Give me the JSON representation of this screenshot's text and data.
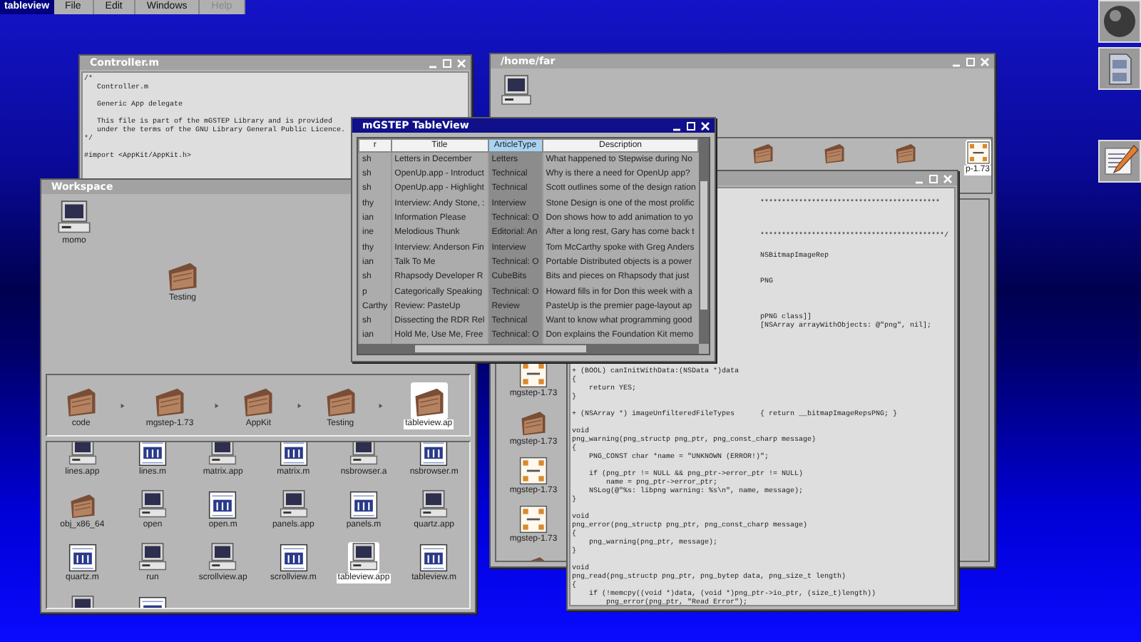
{
  "menu_bar": {
    "app_name": "tableview",
    "items": [
      {
        "label": "File",
        "disabled": false
      },
      {
        "label": "Edit",
        "disabled": false
      },
      {
        "label": "Windows",
        "disabled": false
      },
      {
        "label": "Help",
        "disabled": true
      }
    ]
  },
  "windows": [
    {
      "kind": "editor",
      "title": "Controller.m",
      "active": false,
      "blocks": [
        [
          "/*",
          "   Controller.m"
        ],
        [
          "   Generic App delegate"
        ],
        [
          "   This file is part of the mGSTEP Library and is provided",
          "   under the terms of the GNU Library General Public Licence.",
          "*/"
        ],
        [
          "#import <AppKit/AppKit.h>"
        ]
      ]
    },
    {
      "kind": "file-viewer",
      "title": "/home/far",
      "active": false,
      "shelf": [
        {
          "kind": "monitor"
        }
      ],
      "path": [
        {
          "kind": "folder",
          "selected": false
        },
        {
          "kind": "folder",
          "selected": false
        },
        {
          "kind": "folder",
          "selected": false
        },
        {
          "kind": "archive",
          "label": "p-1.73",
          "selected": true
        }
      ],
      "column": [
        {
          "kind": "archive",
          "label": "mgstep-1.73"
        },
        {
          "kind": "folder",
          "label": "mgstep-1.73"
        },
        {
          "kind": "archive",
          "label": "mgstep-1.73"
        },
        {
          "kind": "archive",
          "label": "mgstep-1.73"
        },
        {
          "kind": "folder"
        }
      ]
    },
    {
      "kind": "editor",
      "active": false,
      "fragments": [
        "******************************************",
        "*******************************************/",
        "NSBitmapImageRep",
        "PNG",
        "pPNG class]]",
        "[NSArray arrayWithObjects: @\"png\", nil];"
      ],
      "blocks": [
        [
          "+ (BOOL) canInitWithData:(NSData *)data",
          "{",
          "    return YES;",
          "}"
        ],
        [
          "+ (NSArray *) imageUnfilteredFileTypes      { return __bitmapImageRepsPNG; }"
        ],
        [
          "void",
          "png_warning(png_structp png_ptr, png_const_charp message)",
          "{",
          "    PNG_CONST char *name = \"UNKNOWN (ERROR!)\";"
        ],
        [
          "    if (png_ptr != NULL && png_ptr->error_ptr != NULL)",
          "        name = png_ptr->error_ptr;",
          "    NSLog(@\"%s: libpng warning: %s\\n\", name, message);",
          "}"
        ],
        [
          "void",
          "png_error(png_structp png_ptr, png_const_charp message)",
          "{",
          "    png_warning(png_ptr, message);",
          "}"
        ],
        [
          "void",
          "png_read(png_structp png_ptr, png_bytep data, png_size_t length)",
          "{",
          "    if (!memcpy((void *)data, (void *)png_ptr->io_ptr, (size_t)length))",
          "        png_error(png_ptr, \"Read Error\");"
        ]
      ]
    },
    {
      "kind": "workspace",
      "title": "Workspace",
      "active": false,
      "shelf": [
        {
          "kind": "monitor",
          "label": "momo"
        },
        {
          "kind": "folder",
          "label": "Testing"
        }
      ],
      "path": [
        {
          "kind": "folder",
          "label": "code",
          "selected": false
        },
        {
          "kind": "folder",
          "label": "mgstep-1.73",
          "selected": false
        },
        {
          "kind": "folder",
          "label": "AppKit",
          "selected": false
        },
        {
          "kind": "folder",
          "label": "Testing",
          "selected": false
        },
        {
          "kind": "folder",
          "label": "tableview.ap",
          "selected": true
        }
      ],
      "grid": [
        {
          "kind": "monitor",
          "label": "lines.app",
          "selected": false
        },
        {
          "kind": "document",
          "label": "lines.m",
          "selected": false
        },
        {
          "kind": "monitor",
          "label": "matrix.app",
          "selected": false
        },
        {
          "kind": "document",
          "label": "matrix.m",
          "selected": false
        },
        {
          "kind": "monitor",
          "label": "nsbrowser.a",
          "selected": false
        },
        {
          "kind": "document",
          "label": "nsbrowser.m",
          "selected": false
        },
        {
          "kind": "folder",
          "label": "obj_x86_64",
          "selected": false
        },
        {
          "kind": "monitor",
          "label": "open",
          "selected": false
        },
        {
          "kind": "document",
          "label": "open.m",
          "selected": false
        },
        {
          "kind": "monitor",
          "label": "panels.app",
          "selected": false
        },
        {
          "kind": "document",
          "label": "panels.m",
          "selected": false
        },
        {
          "kind": "monitor",
          "label": "quartz.app",
          "selected": false
        },
        {
          "kind": "document",
          "label": "quartz.m",
          "selected": false
        },
        {
          "kind": "monitor",
          "label": "run",
          "selected": false
        },
        {
          "kind": "monitor",
          "label": "scrollview.ap",
          "selected": false
        },
        {
          "kind": "document",
          "label": "scrollview.m",
          "selected": false
        },
        {
          "kind": "monitor",
          "label": "tableview.app",
          "selected": true
        },
        {
          "kind": "document",
          "label": "tableview.m",
          "selected": false
        },
        {
          "kind": "monitor",
          "selected": false
        },
        {
          "kind": "document",
          "selected": false
        }
      ]
    },
    {
      "kind": "table",
      "title": "mGSTEP TableView",
      "active": true,
      "columns": [
        {
          "label": "r",
          "selected": false
        },
        {
          "label": "Title",
          "selected": false
        },
        {
          "label": "ArticleType",
          "selected": true
        },
        {
          "label": "Description",
          "selected": false
        }
      ],
      "rows": [
        [
          "sh",
          "Letters in December",
          "Letters",
          "What happened to Stepwise during No"
        ],
        [
          "sh",
          "OpenUp.app - Introduct",
          "Technical",
          "Why is there a need for OpenUp app?"
        ],
        [
          "sh",
          "OpenUp.app - Highlight",
          "Technical",
          "Scott outlines some of the design ration"
        ],
        [
          "thy",
          "Interview: Andy Stone, :",
          "Interview",
          "Stone Design is one of the most prolific"
        ],
        [
          "ian",
          "Information Please",
          "Technical: O",
          "Don shows how to add animation to yo"
        ],
        [
          "ine",
          "Melodious Thunk",
          "Editorial: An",
          "After a long rest, Gary has come back t"
        ],
        [
          "thy",
          "Interview: Anderson Fin",
          "Interview",
          "Tom McCarthy spoke with Greg Anders"
        ],
        [
          "ian",
          "Talk To Me",
          "Technical: O",
          "Portable Distributed objects is a power"
        ],
        [
          "sh",
          "Rhapsody Developer R",
          "CubeBits",
          "Bits and pieces on Rhapsody that just"
        ],
        [
          "p",
          "Categorically Speaking",
          "Technical: O",
          "Howard fills in for Don this week with a"
        ],
        [
          "Carthy",
          "Review: PasteUp",
          "Review",
          "PasteUp is the premier page-layout ap"
        ],
        [
          "sh",
          "Dissecting the RDR Rel",
          "Technical",
          "Want to know what programming good"
        ],
        [
          "ian",
          "Hold Me, Use Me, Free",
          "Technical: O",
          "Don explains the Foundation Kit memo"
        ]
      ]
    }
  ]
}
